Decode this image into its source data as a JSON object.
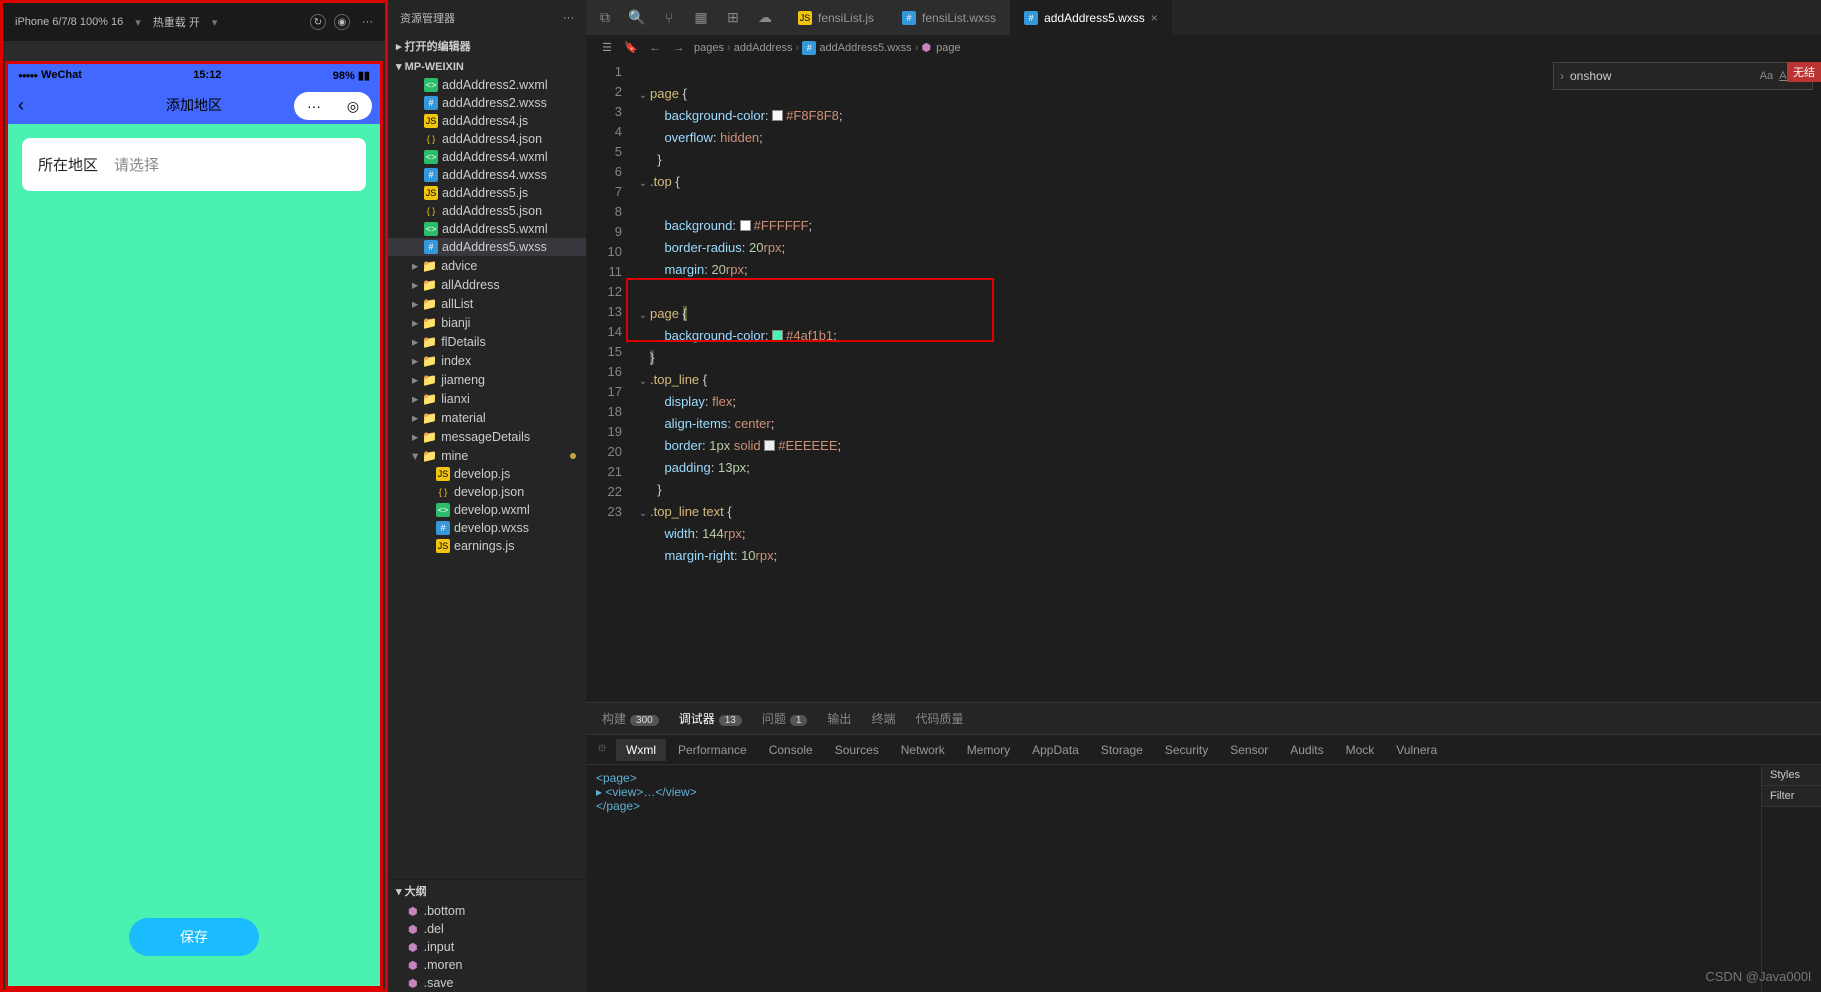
{
  "sim_toolbar": {
    "device": "iPhone 6/7/8 100% 16",
    "hot_reload": "热重载 开",
    "more": "···"
  },
  "phone": {
    "carrier": "WeChat",
    "time": "15:12",
    "battery": "98%",
    "nav_title": "添加地区",
    "field_label": "所在地区",
    "field_placeholder": "请选择",
    "save_btn": "保存"
  },
  "explorer": {
    "title": "资源管理器",
    "more": "···",
    "section_open_editors": "打开的编辑器",
    "section_project": "MP-WEIXIN",
    "files": [
      {
        "name": "addAddress2.wxml",
        "type": "wxml"
      },
      {
        "name": "addAddress2.wxss",
        "type": "wxss"
      },
      {
        "name": "addAddress4.js",
        "type": "js"
      },
      {
        "name": "addAddress4.json",
        "type": "json"
      },
      {
        "name": "addAddress4.wxml",
        "type": "wxml"
      },
      {
        "name": "addAddress4.wxss",
        "type": "wxss"
      },
      {
        "name": "addAddress5.js",
        "type": "js"
      },
      {
        "name": "addAddress5.json",
        "type": "json"
      },
      {
        "name": "addAddress5.wxml",
        "type": "wxml"
      },
      {
        "name": "addAddress5.wxss",
        "type": "wxss",
        "active": true
      }
    ],
    "folders": [
      "advice",
      "allAddress",
      "allList",
      "bianji",
      "flDetails",
      "index",
      "jiameng",
      "lianxi",
      "material",
      "messageDetails"
    ],
    "folder_open": "mine",
    "mine_files": [
      {
        "name": "develop.js",
        "type": "js"
      },
      {
        "name": "develop.json",
        "type": "json"
      },
      {
        "name": "develop.wxml",
        "type": "wxml"
      },
      {
        "name": "develop.wxss",
        "type": "wxss"
      },
      {
        "name": "earnings.js",
        "type": "js"
      }
    ],
    "outline_title": "大纲",
    "outline_items": [
      ".bottom",
      ".del",
      ".input",
      ".moren",
      ".save"
    ]
  },
  "tabs": [
    {
      "name": "fensiList.js",
      "type": "js"
    },
    {
      "name": "fensiList.wxss",
      "type": "wxss"
    },
    {
      "name": "addAddress5.wxss",
      "type": "wxss",
      "active": true
    }
  ],
  "breadcrumb": [
    "pages",
    "addAddress",
    "addAddress5.wxss",
    "page"
  ],
  "find": {
    "value": "onshow",
    "no_result": "无结"
  },
  "code_lines": [
    {
      "n": 1,
      "html": ""
    },
    {
      "n": 2,
      "fold": "v",
      "html": "<span class='sel'>page</span> <span class='pun'>{</span>"
    },
    {
      "n": 3,
      "html": "    <span class='prop'>background-color</span><span class='pun'>:</span> <span class='swatch' style='background:#F8F8F8'></span><span class='val'>#F8F8F8</span><span class='pun'>;</span>"
    },
    {
      "n": 4,
      "html": "    <span class='prop'>overflow</span><span class='pun'>:</span> <span class='val'>hidden</span><span class='pun'>;</span>"
    },
    {
      "n": 5,
      "html": "  <span class='pun'>}</span>"
    },
    {
      "n": 6,
      "fold": "v",
      "html": "<span class='sel'>.top</span> <span class='pun'>{</span>"
    },
    {
      "n": 7,
      "html": ""
    },
    {
      "n": 8,
      "html": "    <span class='prop'>background</span><span class='pun'>:</span> <span class='swatch' style='background:#FFFFFF'></span><span class='val'>#FFFFFF</span><span class='pun'>;</span>"
    },
    {
      "n": 9,
      "html": "    <span class='prop'>border-radius</span><span class='pun'>:</span> <span class='num'>20</span><span class='val'>rpx</span><span class='pun'>;</span>"
    },
    {
      "n": 10,
      "html": "    <span class='prop'>margin</span><span class='pun'>:</span> <span class='num'>20</span><span class='val'>rpx</span><span class='pun'>;</span>"
    },
    {
      "n": 11,
      "html": ""
    },
    {
      "n": 12,
      "fold": "v",
      "html": "<span class='sel'>page</span> <span class='pun' style='background:#5a5a2a'>{</span>"
    },
    {
      "n": 13,
      "html": "    <span class='prop'>background-color</span><span class='pun'>:</span> <span class='swatch' style='background:#4af1b1'></span><span class='val'>#4af1b1</span><span class='pun'>;</span>"
    },
    {
      "n": 14,
      "html": "<span class='pun' style='background:#444'>}</span>"
    },
    {
      "n": 15,
      "fold": "v",
      "html": "<span class='sel'>.top_line</span> <span class='pun'>{</span>"
    },
    {
      "n": 16,
      "html": "    <span class='prop'>display</span><span class='pun'>:</span> <span class='val'>flex</span><span class='pun'>;</span>"
    },
    {
      "n": 17,
      "html": "    <span class='prop'>align-items</span><span class='pun'>:</span> <span class='val'>center</span><span class='pun'>;</span>"
    },
    {
      "n": 18,
      "html": "    <span class='prop'>border</span><span class='pun'>:</span> <span class='num'>1px</span> <span class='val'>solid</span> <span class='swatch' style='background:#EEEEEE'></span><span class='val'>#EEEEEE</span><span class='pun'>;</span>"
    },
    {
      "n": 19,
      "html": "    <span class='prop'>padding</span><span class='pun'>:</span> <span class='num'>13px</span><span class='pun'>;</span>"
    },
    {
      "n": 20,
      "html": "  <span class='pun'>}</span>"
    },
    {
      "n": 21,
      "fold": "v",
      "html": "<span class='sel'>.top_line text</span> <span class='pun'>{</span>"
    },
    {
      "n": 22,
      "html": "    <span class='prop'>width</span><span class='pun'>:</span> <span class='num'>144</span><span class='val'>rpx</span><span class='pun'>;</span>"
    },
    {
      "n": 23,
      "html": "    <span class='prop'>margin-right</span><span class='pun'>:</span> <span class='num'>10</span><span class='val'>rpx</span><span class='pun'>;</span>"
    }
  ],
  "panel": {
    "top_tabs": [
      {
        "label": "构建",
        "badge": "300"
      },
      {
        "label": "调试器",
        "badge": "13",
        "active": true
      },
      {
        "label": "问题",
        "badge": "1"
      },
      {
        "label": "输出"
      },
      {
        "label": "终端"
      },
      {
        "label": "代码质量"
      }
    ],
    "devtools": [
      "Wxml",
      "Performance",
      "Console",
      "Sources",
      "Network",
      "Memory",
      "AppData",
      "Storage",
      "Security",
      "Sensor",
      "Audits",
      "Mock",
      "Vulnera"
    ],
    "devtools_active": "Wxml",
    "styles_label": "Styles",
    "filter_label": "Filter",
    "wxml_lines": [
      "<page>",
      "  ▸ <view>…</view>",
      "</page>"
    ]
  },
  "watermark": "CSDN @Java000l"
}
